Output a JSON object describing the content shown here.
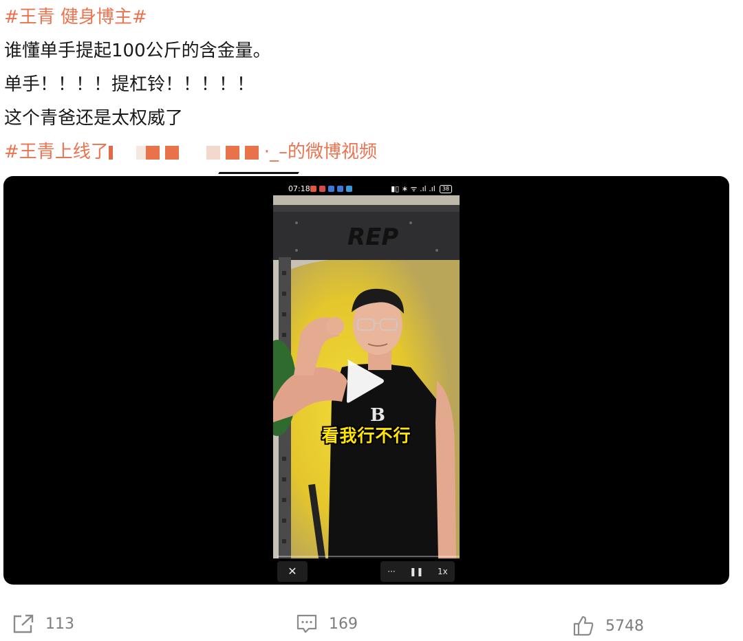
{
  "post": {
    "line1": {
      "tag": "#王青 健身博主#"
    },
    "line2": "谁懂单手提起100公斤的含金量。",
    "line3": "单手！！！！提杠铃！！！！！",
    "line4": "这个青爸还是太权威了",
    "line5": {
      "tag": "#王青上线了",
      "suffix": "·_–的微博视频"
    }
  },
  "video": {
    "status_time": "07:18",
    "battery": "38",
    "caption": "看我行不行",
    "rack_brand": "REP",
    "controls": {
      "close": "✕",
      "more": "···",
      "pause": "❚❚",
      "speed": "1x"
    }
  },
  "actions": {
    "share_count": "113",
    "comment_count": "169",
    "like_count": "5748"
  },
  "colors": {
    "hashtag": "#eb7350",
    "redaction": "#e8734a",
    "caption": "#ffe500",
    "wall_light": "#f1d226"
  },
  "icons": {
    "share": "share-icon",
    "comment": "comment-icon",
    "like": "thumbs-up-icon",
    "play": "play-icon"
  }
}
